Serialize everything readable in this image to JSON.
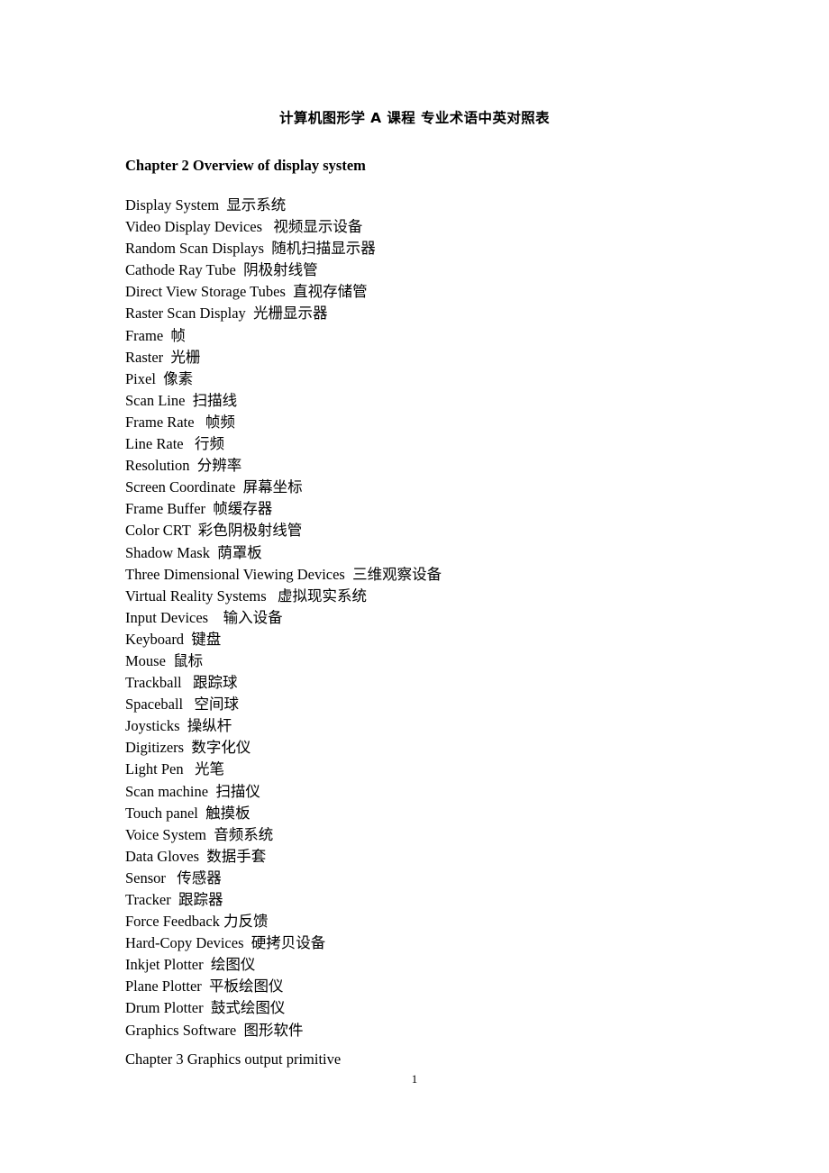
{
  "document": {
    "title": "计算机图形学 A 课程 专业术语中英对照表",
    "page_number": "1"
  },
  "chapter": {
    "heading": "Chapter 2 Overview of display system"
  },
  "terms": [
    {
      "en": "Display System",
      "zh": "显示系统",
      "line": "Display System  显示系统"
    },
    {
      "en": "Video Display Devices",
      "zh": "视频显示设备",
      "line": "Video Display Devices   视频显示设备"
    },
    {
      "en": "Random Scan Displays",
      "zh": "随机扫描显示器",
      "line": "Random Scan Displays  随机扫描显示器"
    },
    {
      "en": "Cathode Ray Tube",
      "zh": "阴极射线管",
      "line": "Cathode Ray Tube  阴极射线管"
    },
    {
      "en": "Direct View Storage Tubes",
      "zh": "直视存储管",
      "line": "Direct View Storage Tubes  直视存储管"
    },
    {
      "en": "Raster Scan Display",
      "zh": "光栅显示器",
      "line": "Raster Scan Display  光栅显示器"
    },
    {
      "en": "Frame",
      "zh": "帧",
      "line": "Frame  帧"
    },
    {
      "en": "Raster",
      "zh": "光栅",
      "line": "Raster  光栅"
    },
    {
      "en": "Pixel",
      "zh": "像素",
      "line": "Pixel  像素"
    },
    {
      "en": "Scan Line",
      "zh": "扫描线",
      "line": "Scan Line  扫描线"
    },
    {
      "en": "Frame Rate",
      "zh": "帧频",
      "line": "Frame Rate   帧频"
    },
    {
      "en": "Line Rate",
      "zh": "行频",
      "line": "Line Rate   行频"
    },
    {
      "en": "Resolution",
      "zh": "分辨率",
      "line": "Resolution  分辨率"
    },
    {
      "en": "Screen Coordinate",
      "zh": "屏幕坐标",
      "line": "Screen Coordinate  屏幕坐标"
    },
    {
      "en": "Frame Buffer",
      "zh": "帧缓存器",
      "line": "Frame Buffer  帧缓存器"
    },
    {
      "en": "Color CRT",
      "zh": "彩色阴极射线管",
      "line": "Color CRT  彩色阴极射线管"
    },
    {
      "en": "Shadow Mask",
      "zh": "荫罩板",
      "line": "Shadow Mask  荫罩板"
    },
    {
      "en": "Three Dimensional Viewing Devices",
      "zh": "三维观察设备",
      "line": "Three Dimensional Viewing Devices  三维观察设备"
    },
    {
      "en": "Virtual Reality Systems",
      "zh": "虚拟现实系统",
      "line": "Virtual Reality Systems   虚拟现实系统"
    },
    {
      "en": "Input Devices",
      "zh": "输入设备",
      "line": "Input Devices    输入设备"
    },
    {
      "en": "Keyboard",
      "zh": "键盘",
      "line": "Keyboard  键盘"
    },
    {
      "en": "Mouse",
      "zh": "鼠标",
      "line": "Mouse  鼠标"
    },
    {
      "en": "Trackball",
      "zh": "跟踪球",
      "line": "Trackball   跟踪球"
    },
    {
      "en": "Spaceball",
      "zh": "空间球",
      "line": "Spaceball   空间球"
    },
    {
      "en": "Joysticks",
      "zh": "操纵杆",
      "line": "Joysticks  操纵杆"
    },
    {
      "en": "Digitizers",
      "zh": "数字化仪",
      "line": "Digitizers  数字化仪"
    },
    {
      "en": "Light Pen",
      "zh": "光笔",
      "line": "Light Pen   光笔"
    },
    {
      "en": "Scan machine",
      "zh": "扫描仪",
      "line": "Scan machine  扫描仪"
    },
    {
      "en": "Touch panel",
      "zh": "触摸板",
      "line": "Touch panel  触摸板"
    },
    {
      "en": "Voice System",
      "zh": "音频系统",
      "line": "Voice System  音频系统"
    },
    {
      "en": "Data Gloves",
      "zh": "数据手套",
      "line": "Data Gloves  数据手套"
    },
    {
      "en": "Sensor",
      "zh": "传感器",
      "line": "Sensor   传感器"
    },
    {
      "en": "Tracker",
      "zh": "跟踪器",
      "line": "Tracker  跟踪器"
    },
    {
      "en": "Force Feedback",
      "zh": "力反馈",
      "line": "Force Feedback 力反馈"
    },
    {
      "en": "Hard-Copy Devices",
      "zh": "硬拷贝设备",
      "line": "Hard-Copy Devices  硬拷贝设备"
    },
    {
      "en": "Inkjet Plotter",
      "zh": "绘图仪",
      "line": "Inkjet Plotter  绘图仪"
    },
    {
      "en": "Plane Plotter",
      "zh": "平板绘图仪",
      "line": "Plane Plotter  平板绘图仪"
    },
    {
      "en": "Drum Plotter",
      "zh": "鼓式绘图仪",
      "line": "Drum Plotter  鼓式绘图仪"
    },
    {
      "en": "Graphics Software",
      "zh": "图形软件",
      "line": "Graphics Software  图形软件"
    }
  ],
  "next_chapter": {
    "heading": "Chapter 3 Graphics output primitive"
  }
}
